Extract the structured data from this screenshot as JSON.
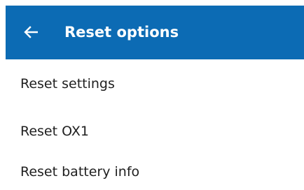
{
  "header": {
    "title": "Reset options",
    "back_icon": "arrow-left-icon",
    "color": "#0c6bb4"
  },
  "menu": {
    "items": [
      {
        "label": "Reset settings"
      },
      {
        "label": "Reset OX1"
      },
      {
        "label": "Reset battery info"
      }
    ]
  }
}
